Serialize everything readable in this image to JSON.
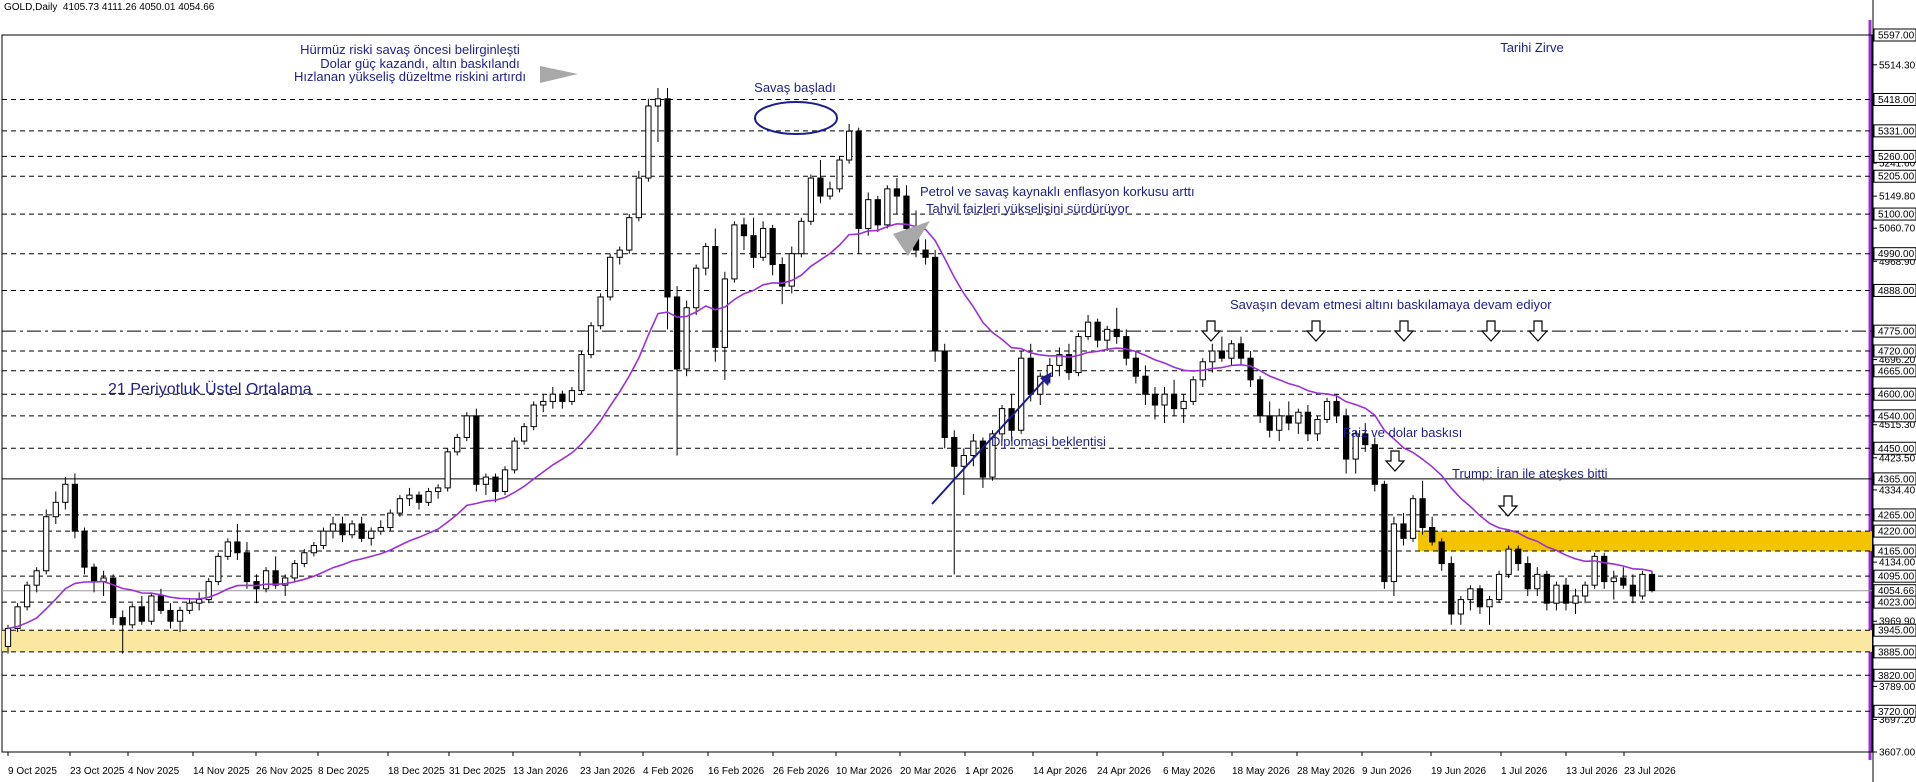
{
  "header": {
    "symbol": "GOLD,Daily",
    "ohlc": "4105.73 4111.26 4050.01 4054.66"
  },
  "colors": {
    "candle": "#000000",
    "ema": "#9b30d9",
    "annotation_text": "#1e1e8c",
    "ema_label": "#a020f0",
    "zone": "#f5c400",
    "zone_light": "#fae8a0",
    "grid": "#000000",
    "right_border": "#9b30d9"
  },
  "annotations": {
    "hormuz": [
      "Hürmüz riski savaş öncesi belirginleşti",
      "Dolar güç kazandı, altın baskılandı",
      "Hızlanan yükseliş düzeltme riskini artırdı"
    ],
    "war_started": "Savaş başladı",
    "all_time_high": "Tarihi Zirve",
    "petrol": [
      "Petrol ve savaş kaynaklı enflasyon korkusu arttı",
      "Tahvil faizleri yükselişini sürdürüyor"
    ],
    "war_continues": "Savaşın devam etmesi altını baskılamaya devam ediyor",
    "ema_label": "21 Periyotluk Üstel Ortalama",
    "diplomacy": "Diplomasi beklentisi",
    "rates_dollar": "Faiz ve dolar baskısı",
    "trump": "Trump: İran ile ateşkes bitti"
  },
  "price_levels": {
    "solid": [
      "5597.00",
      "4365.00",
      "4054.66"
    ],
    "dashed": [
      "5418.00",
      "5331.00",
      "5260.00",
      "5205.00",
      "5100.00",
      "4990.00",
      "4888.00",
      "4720.00",
      "4665.00",
      "4600.00",
      "4540.00",
      "4450.00",
      "4265.00",
      "4220.00",
      "4165.00",
      "4095.00",
      "4023.00",
      "3945.00",
      "3885.00",
      "3820.00",
      "3720.00"
    ],
    "dashdot": [
      "4775.00"
    ],
    "extra_ticks": [
      "5514.30",
      "5241.60",
      "5149.80",
      "5060.70",
      "4968.90",
      "4696.20",
      "4515.30",
      "4423.50",
      "4334.40",
      "4134.00",
      "3969.90",
      "3789.00",
      "3697.20",
      "3607.00"
    ]
  },
  "zones": [
    {
      "top": "4220.00",
      "bottom": "4165.00",
      "style": "solid"
    },
    {
      "top": "3945.00",
      "bottom": "3885.00",
      "style": "light"
    }
  ],
  "x_axis": {
    "labels": [
      "9 Oct 2025",
      "23 Oct 2025",
      "4 Nov 2025",
      "14 Nov 2025",
      "26 Nov 2025",
      "8 Dec 2025",
      "18 Dec 2025",
      "31 Dec 2025",
      "13 Jan 2026",
      "23 Jan 2026",
      "4 Feb 2026",
      "16 Feb 2026",
      "26 Feb 2026",
      "10 Mar 2026",
      "20 Mar 2026",
      "1 Apr 2026",
      "14 Apr 2026",
      "24 Apr 2026",
      "6 May 2026",
      "18 May 2026",
      "28 May 2026",
      "9 Jun 2026",
      "19 Jun 2026",
      "1 Jul 2026",
      "13 Jul 2026",
      "23 Jul 2026"
    ]
  },
  "chart_data": {
    "type": "candlestick",
    "title": "GOLD,Daily",
    "series": [
      {
        "name": "GOLD,Daily",
        "values": [
          [
            3900,
            3960,
            3880,
            3950
          ],
          [
            3950,
            4020,
            3940,
            4010
          ],
          [
            4010,
            4080,
            4000,
            4070
          ],
          [
            4070,
            4120,
            4050,
            4110
          ],
          [
            4110,
            4280,
            4100,
            4260
          ],
          [
            4260,
            4330,
            4240,
            4300
          ],
          [
            4300,
            4370,
            4280,
            4350
          ],
          [
            4350,
            4380,
            4200,
            4220
          ],
          [
            4220,
            4230,
            4100,
            4120
          ],
          [
            4120,
            4130,
            4050,
            4080
          ],
          [
            4080,
            4110,
            4040,
            4090
          ],
          [
            4090,
            4100,
            3960,
            3980
          ],
          [
            3980,
            4000,
            3880,
            3960
          ],
          [
            3960,
            4020,
            3950,
            4010
          ],
          [
            4010,
            4040,
            3960,
            3970
          ],
          [
            3970,
            4050,
            3960,
            4040
          ],
          [
            4040,
            4060,
            3990,
            4000
          ],
          [
            4000,
            4020,
            3950,
            3970
          ],
          [
            3970,
            4010,
            3940,
            4000
          ],
          [
            4000,
            4030,
            3990,
            4020
          ],
          [
            4020,
            4050,
            4000,
            4030
          ],
          [
            4030,
            4090,
            4020,
            4080
          ],
          [
            4080,
            4160,
            4070,
            4150
          ],
          [
            4150,
            4200,
            4140,
            4190
          ],
          [
            4190,
            4240,
            4140,
            4160
          ],
          [
            4160,
            4190,
            4060,
            4080
          ],
          [
            4080,
            4100,
            4020,
            4060
          ],
          [
            4060,
            4120,
            4050,
            4110
          ],
          [
            4110,
            4150,
            4060,
            4070
          ],
          [
            4070,
            4100,
            4040,
            4090
          ],
          [
            4090,
            4140,
            4080,
            4130
          ],
          [
            4130,
            4170,
            4120,
            4160
          ],
          [
            4160,
            4190,
            4150,
            4180
          ],
          [
            4180,
            4230,
            4170,
            4220
          ],
          [
            4220,
            4260,
            4200,
            4240
          ],
          [
            4240,
            4260,
            4190,
            4210
          ],
          [
            4210,
            4250,
            4200,
            4240
          ],
          [
            4240,
            4260,
            4190,
            4200
          ],
          [
            4200,
            4230,
            4180,
            4220
          ],
          [
            4220,
            4250,
            4210,
            4230
          ],
          [
            4230,
            4280,
            4220,
            4270
          ],
          [
            4270,
            4320,
            4260,
            4310
          ],
          [
            4310,
            4340,
            4290,
            4320
          ],
          [
            4320,
            4330,
            4280,
            4300
          ],
          [
            4300,
            4340,
            4290,
            4330
          ],
          [
            4330,
            4350,
            4310,
            4340
          ],
          [
            4340,
            4450,
            4330,
            4440
          ],
          [
            4440,
            4490,
            4430,
            4480
          ],
          [
            4480,
            4550,
            4470,
            4540
          ],
          [
            4540,
            4560,
            4330,
            4350
          ],
          [
            4350,
            4380,
            4320,
            4370
          ],
          [
            4370,
            4380,
            4300,
            4330
          ],
          [
            4330,
            4400,
            4320,
            4390
          ],
          [
            4390,
            4480,
            4380,
            4470
          ],
          [
            4470,
            4520,
            4460,
            4510
          ],
          [
            4510,
            4580,
            4500,
            4570
          ],
          [
            4570,
            4600,
            4550,
            4580
          ],
          [
            4580,
            4620,
            4560,
            4600
          ],
          [
            4600,
            4610,
            4560,
            4580
          ],
          [
            4580,
            4620,
            4570,
            4610
          ],
          [
            4610,
            4720,
            4600,
            4710
          ],
          [
            4710,
            4800,
            4700,
            4790
          ],
          [
            4790,
            4880,
            4780,
            4870
          ],
          [
            4870,
            4990,
            4860,
            4980
          ],
          [
            4980,
            5010,
            4960,
            5000
          ],
          [
            5000,
            5100,
            4990,
            5090
          ],
          [
            5090,
            5220,
            5080,
            5200
          ],
          [
            5200,
            5420,
            5190,
            5400
          ],
          [
            5400,
            5450,
            5300,
            5420
          ],
          [
            5420,
            5450,
            4780,
            4870
          ],
          [
            4870,
            4900,
            4430,
            4670
          ],
          [
            4670,
            4860,
            4650,
            4840
          ],
          [
            4840,
            4960,
            4820,
            4950
          ],
          [
            4950,
            5020,
            4930,
            5010
          ],
          [
            5010,
            5060,
            4690,
            4730
          ],
          [
            4730,
            4940,
            4640,
            4920
          ],
          [
            4920,
            5080,
            4910,
            5070
          ],
          [
            5070,
            5090,
            5000,
            5040
          ],
          [
            5040,
            5090,
            4950,
            4980
          ],
          [
            4980,
            5080,
            4970,
            5060
          ],
          [
            5060,
            5070,
            4930,
            4960
          ],
          [
            4960,
            4980,
            4850,
            4900
          ],
          [
            4900,
            5010,
            4880,
            4990
          ],
          [
            4990,
            5090,
            4980,
            5080
          ],
          [
            5080,
            5210,
            5070,
            5200
          ],
          [
            5200,
            5250,
            5130,
            5150
          ],
          [
            5150,
            5190,
            5140,
            5170
          ],
          [
            5170,
            5260,
            5160,
            5250
          ],
          [
            5250,
            5350,
            5240,
            5330
          ],
          [
            5330,
            5340,
            4990,
            5060
          ],
          [
            5060,
            5160,
            5040,
            5140
          ],
          [
            5140,
            5150,
            5050,
            5070
          ],
          [
            5070,
            5180,
            5060,
            5170
          ],
          [
            5170,
            5200,
            5100,
            5150
          ],
          [
            5150,
            5180,
            5020,
            5060
          ],
          [
            5060,
            5110,
            4980,
            5000
          ],
          [
            5000,
            5030,
            4960,
            4980
          ],
          [
            4980,
            5000,
            4690,
            4720
          ],
          [
            4720,
            4740,
            4450,
            4480
          ],
          [
            4480,
            4500,
            4100,
            4400
          ],
          [
            4400,
            4450,
            4320,
            4430
          ],
          [
            4430,
            4490,
            4400,
            4470
          ],
          [
            4470,
            4480,
            4340,
            4370
          ],
          [
            4370,
            4500,
            4360,
            4490
          ],
          [
            4490,
            4570,
            4470,
            4560
          ],
          [
            4560,
            4600,
            4470,
            4500
          ],
          [
            4500,
            4720,
            4490,
            4700
          ],
          [
            4700,
            4740,
            4580,
            4600
          ],
          [
            4600,
            4660,
            4570,
            4650
          ],
          [
            4650,
            4700,
            4630,
            4680
          ],
          [
            4680,
            4730,
            4650,
            4710
          ],
          [
            4710,
            4740,
            4640,
            4660
          ],
          [
            4660,
            4770,
            4650,
            4760
          ],
          [
            4760,
            4820,
            4750,
            4800
          ],
          [
            4800,
            4810,
            4730,
            4750
          ],
          [
            4750,
            4790,
            4720,
            4780
          ],
          [
            4780,
            4840,
            4740,
            4760
          ],
          [
            4760,
            4780,
            4680,
            4700
          ],
          [
            4700,
            4720,
            4630,
            4650
          ],
          [
            4650,
            4680,
            4570,
            4600
          ],
          [
            4600,
            4620,
            4530,
            4570
          ],
          [
            4570,
            4620,
            4520,
            4600
          ],
          [
            4600,
            4640,
            4540,
            4560
          ],
          [
            4560,
            4600,
            4520,
            4580
          ],
          [
            4580,
            4650,
            4570,
            4640
          ],
          [
            4640,
            4700,
            4620,
            4690
          ],
          [
            4690,
            4740,
            4660,
            4720
          ],
          [
            4720,
            4760,
            4690,
            4700
          ],
          [
            4700,
            4750,
            4680,
            4740
          ],
          [
            4740,
            4760,
            4680,
            4700
          ],
          [
            4700,
            4720,
            4620,
            4640
          ],
          [
            4640,
            4650,
            4520,
            4540
          ],
          [
            4540,
            4580,
            4480,
            4500
          ],
          [
            4500,
            4560,
            4470,
            4540
          ],
          [
            4540,
            4580,
            4500,
            4520
          ],
          [
            4520,
            4560,
            4490,
            4550
          ],
          [
            4550,
            4570,
            4470,
            4490
          ],
          [
            4490,
            4540,
            4470,
            4530
          ],
          [
            4530,
            4590,
            4520,
            4580
          ],
          [
            4580,
            4600,
            4520,
            4540
          ],
          [
            4540,
            4560,
            4380,
            4420
          ],
          [
            4420,
            4500,
            4380,
            4490
          ],
          [
            4490,
            4520,
            4440,
            4460
          ],
          [
            4460,
            4480,
            4330,
            4350
          ],
          [
            4350,
            4360,
            4060,
            4080
          ],
          [
            4080,
            4260,
            4040,
            4240
          ],
          [
            4240,
            4270,
            4180,
            4200
          ],
          [
            4200,
            4320,
            4190,
            4310
          ],
          [
            4310,
            4360,
            4210,
            4230
          ],
          [
            4230,
            4260,
            4180,
            4190
          ],
          [
            4190,
            4200,
            4110,
            4130
          ],
          [
            4130,
            4150,
            3960,
            3990
          ],
          [
            3990,
            4040,
            3960,
            4030
          ],
          [
            4030,
            4070,
            4000,
            4060
          ],
          [
            4060,
            4070,
            3990,
            4010
          ],
          [
            4010,
            4040,
            3960,
            4030
          ],
          [
            4030,
            4110,
            4020,
            4100
          ],
          [
            4100,
            4180,
            4090,
            4170
          ],
          [
            4170,
            4180,
            4110,
            4130
          ],
          [
            4130,
            4150,
            4040,
            4060
          ],
          [
            4060,
            4120,
            4040,
            4100
          ],
          [
            4100,
            4110,
            4000,
            4020
          ],
          [
            4020,
            4080,
            4000,
            4070
          ],
          [
            4070,
            4090,
            4000,
            4020
          ],
          [
            4020,
            4060,
            3990,
            4040
          ],
          [
            4040,
            4080,
            4020,
            4070
          ],
          [
            4070,
            4160,
            4060,
            4150
          ],
          [
            4150,
            4160,
            4060,
            4080
          ],
          [
            4080,
            4110,
            4030,
            4090
          ],
          [
            4090,
            4120,
            4060,
            4070
          ],
          [
            4070,
            4100,
            4020,
            4040
          ],
          [
            4040,
            4110,
            4030,
            4100
          ],
          [
            4100,
            4110,
            4050,
            4055
          ]
        ]
      }
    ],
    "ema": {
      "name": "21 Periyotluk Üstel Ortalama",
      "period": 21
    },
    "yrange": [
      3607,
      5597
    ],
    "xlabel": "",
    "ylabel": "",
    "grid": false
  }
}
